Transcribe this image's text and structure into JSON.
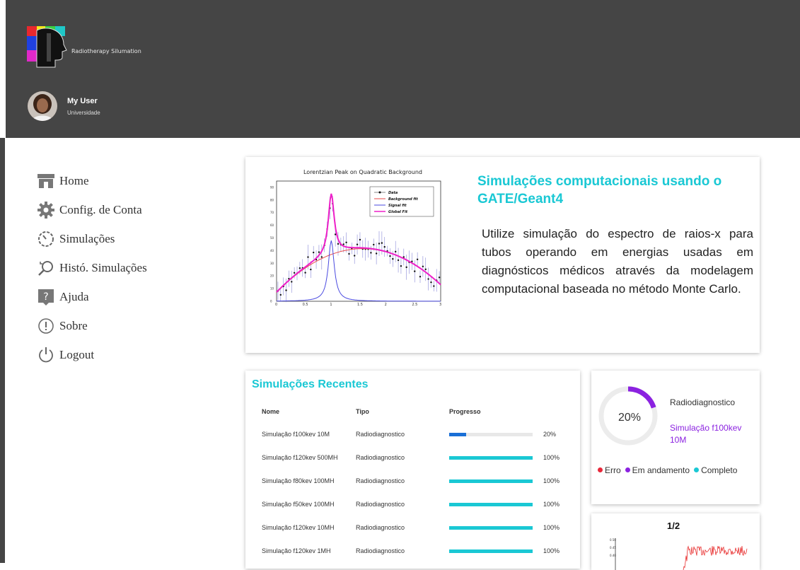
{
  "app": {
    "logo_text": "Radiotherapy Silumation"
  },
  "user": {
    "name": "My User",
    "org": "Universidade"
  },
  "nav": [
    {
      "label": "Home",
      "icon": "home-store-icon"
    },
    {
      "label": "Config. de Conta",
      "icon": "gear-icon"
    },
    {
      "label": "Simulações",
      "icon": "timer-icon"
    },
    {
      "label": "Histó. Simulações",
      "icon": "history-search-icon"
    },
    {
      "label": "Ajuda",
      "icon": "help-icon"
    },
    {
      "label": "Sobre",
      "icon": "info-icon"
    },
    {
      "label": "Logout",
      "icon": "power-icon"
    }
  ],
  "hero": {
    "title": "Simulações computacionais usando o GATE/Geant4",
    "text": "Utilize simulação do espectro de raios-x para tubos operando em energias usadas em diagnósticos médicos através da modelagem computacional baseada no método Monte Carlo."
  },
  "hero_chart": {
    "title": "Lorentzian Peak on Quadratic Background",
    "x_ticks": [
      "0",
      "0.5",
      "1",
      "1.5",
      "2",
      "2.5",
      "3"
    ],
    "y_ticks": [
      "0",
      "10",
      "20",
      "30",
      "40",
      "50",
      "60",
      "70",
      "80",
      "90"
    ],
    "legend": [
      "Data",
      "Background fit",
      "Signal fit",
      "Global Fit"
    ]
  },
  "recent": {
    "title": "Simulações Recentes",
    "headers": {
      "name": "Nome",
      "type": "Tipo",
      "progress": "Progresso"
    },
    "rows": [
      {
        "name": "Simulação f100kev 10M",
        "type": "Radiodiagnostico",
        "pct": "20%",
        "progress": 0.2
      },
      {
        "name": "Simulação f120kev 500MH",
        "type": "Radiodiagnostico",
        "pct": "100%",
        "progress": 1.0
      },
      {
        "name": "Simulação f80kev 100MH",
        "type": "Radiodiagnostico",
        "pct": "100%",
        "progress": 1.0
      },
      {
        "name": "Simulação f50kev 100MH",
        "type": "Radiodiagnostico",
        "pct": "100%",
        "progress": 1.0
      },
      {
        "name": "Simulação f120kev 10MH",
        "type": "Radiodiagnostico",
        "pct": "100%",
        "progress": 1.0
      },
      {
        "name": "Simulação f120kev 1MH",
        "type": "Radiodiagnostico",
        "pct": "100%",
        "progress": 1.0
      }
    ]
  },
  "status_card": {
    "percent": "20%",
    "progress": 0.2,
    "type": "Radiodiagnostico",
    "simulation": "Simulação f100kev 10M",
    "legend": [
      {
        "label": "Erro",
        "color": "#e8283a"
      },
      {
        "label": "Em andamento",
        "color": "#8b22e0"
      },
      {
        "label": "Completo",
        "color": "#1ac8d4"
      }
    ]
  },
  "mini_card": {
    "title": "1/2",
    "y_ticks": [
      "0.50",
      "0.45",
      "0.40"
    ]
  },
  "colors": {
    "accent": "#1ac8d4",
    "purple": "#8b22e0",
    "bar_partial": "#1a6fd6",
    "header": "#454545"
  }
}
